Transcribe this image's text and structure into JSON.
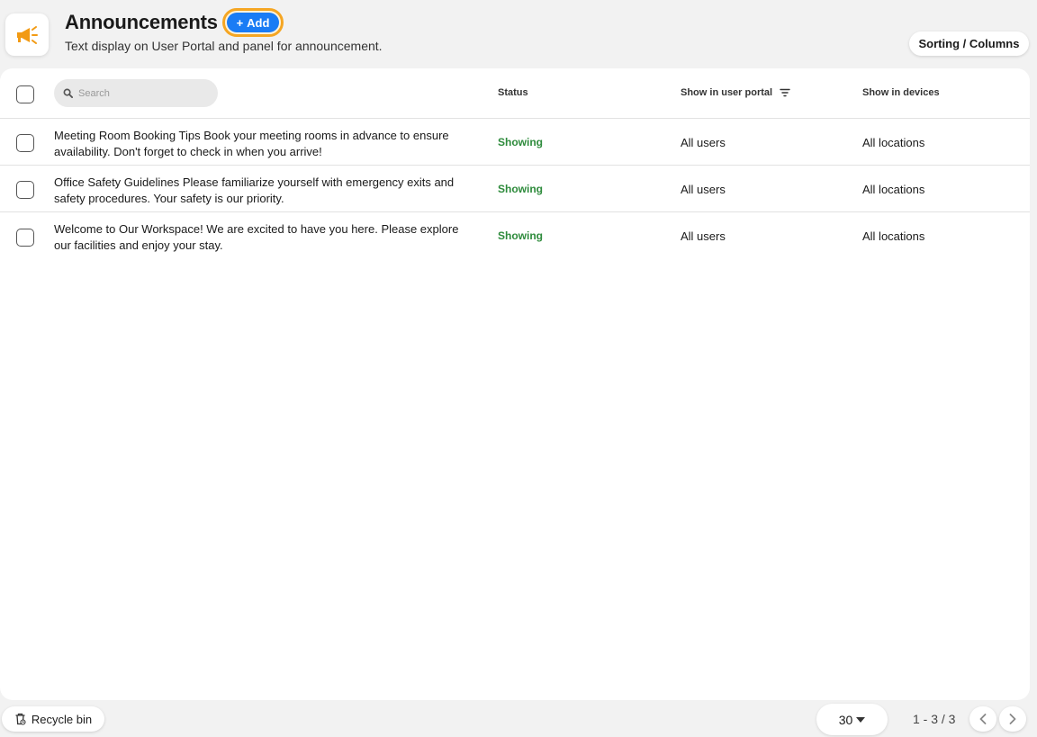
{
  "header": {
    "title": "Announcements",
    "add_label": "Add",
    "subtitle": "Text display on User Portal and panel for announcement.",
    "sort_label": "Sorting / Columns",
    "icon": "megaphone-icon"
  },
  "table": {
    "search_placeholder": "Search",
    "columns": {
      "status": "Status",
      "portal": "Show in user portal",
      "devices": "Show in devices"
    },
    "rows": [
      {
        "title": "Meeting Room Booking Tips Book your meeting rooms in advance to ensure availability. Don't forget to check in when you arrive!",
        "status": "Showing",
        "portal": "All users",
        "devices": "All locations"
      },
      {
        "title": "Office Safety Guidelines Please familiarize yourself with emergency exits and safety procedures. Your safety is our priority.",
        "status": "Showing",
        "portal": "All users",
        "devices": "All locations"
      },
      {
        "title": "Welcome to Our Workspace! We are excited to have you here. Please explore our facilities and enjoy your stay.",
        "status": "Showing",
        "portal": "All users",
        "devices": "All locations"
      }
    ]
  },
  "footer": {
    "recycle_label": "Recycle bin",
    "per_page": "30",
    "range": "1 - 3 / 3"
  },
  "colors": {
    "accent": "#1a7cf5",
    "highlight": "#f5a623",
    "status_green": "#2e8b3c",
    "icon_orange": "#f29a13"
  }
}
